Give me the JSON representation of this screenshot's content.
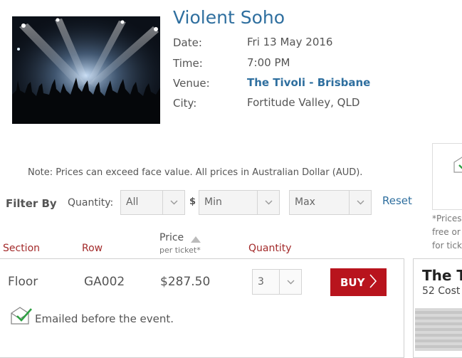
{
  "event": {
    "title": "Violent Soho",
    "details": [
      {
        "label": "Date:",
        "value": "Fri 13 May 2016"
      },
      {
        "label": "Time:",
        "value": "7:00 PM"
      },
      {
        "label": "Venue:",
        "value": "The Tivoli - Brisbane"
      },
      {
        "label": "City:",
        "value": "Fortitude Valley, QLD"
      }
    ],
    "image_icon": "concert-crowd-image"
  },
  "note": "Note: Prices can exceed face value. All prices in Australian Dollar (AUD).",
  "filters": {
    "filter_by_label": "Filter By",
    "quantity_label": "Quantity:",
    "quantity_value": "All",
    "currency_symbol": "$",
    "min_value": "Min",
    "max_value": "Max",
    "reset_label": "Reset"
  },
  "table": {
    "columns": {
      "section": "Section",
      "row": "Row",
      "price": "Price",
      "price_sub": "per ticket*",
      "quantity": "Quantity"
    },
    "rows": [
      {
        "section": "Floor",
        "row": "GA002",
        "price": "$287.50",
        "quantity": "3",
        "buy_label": "BUY",
        "delivery": "Emailed before the event."
      }
    ]
  },
  "side": {
    "note_lines": [
      "*Prices",
      "free or",
      "for tick"
    ],
    "venue_title": "The Ti",
    "venue_address": "52 Cost"
  },
  "colors": {
    "accent": "#2f6f9f",
    "column_header": "#a32a2a",
    "buy_button": "#b8141d"
  }
}
